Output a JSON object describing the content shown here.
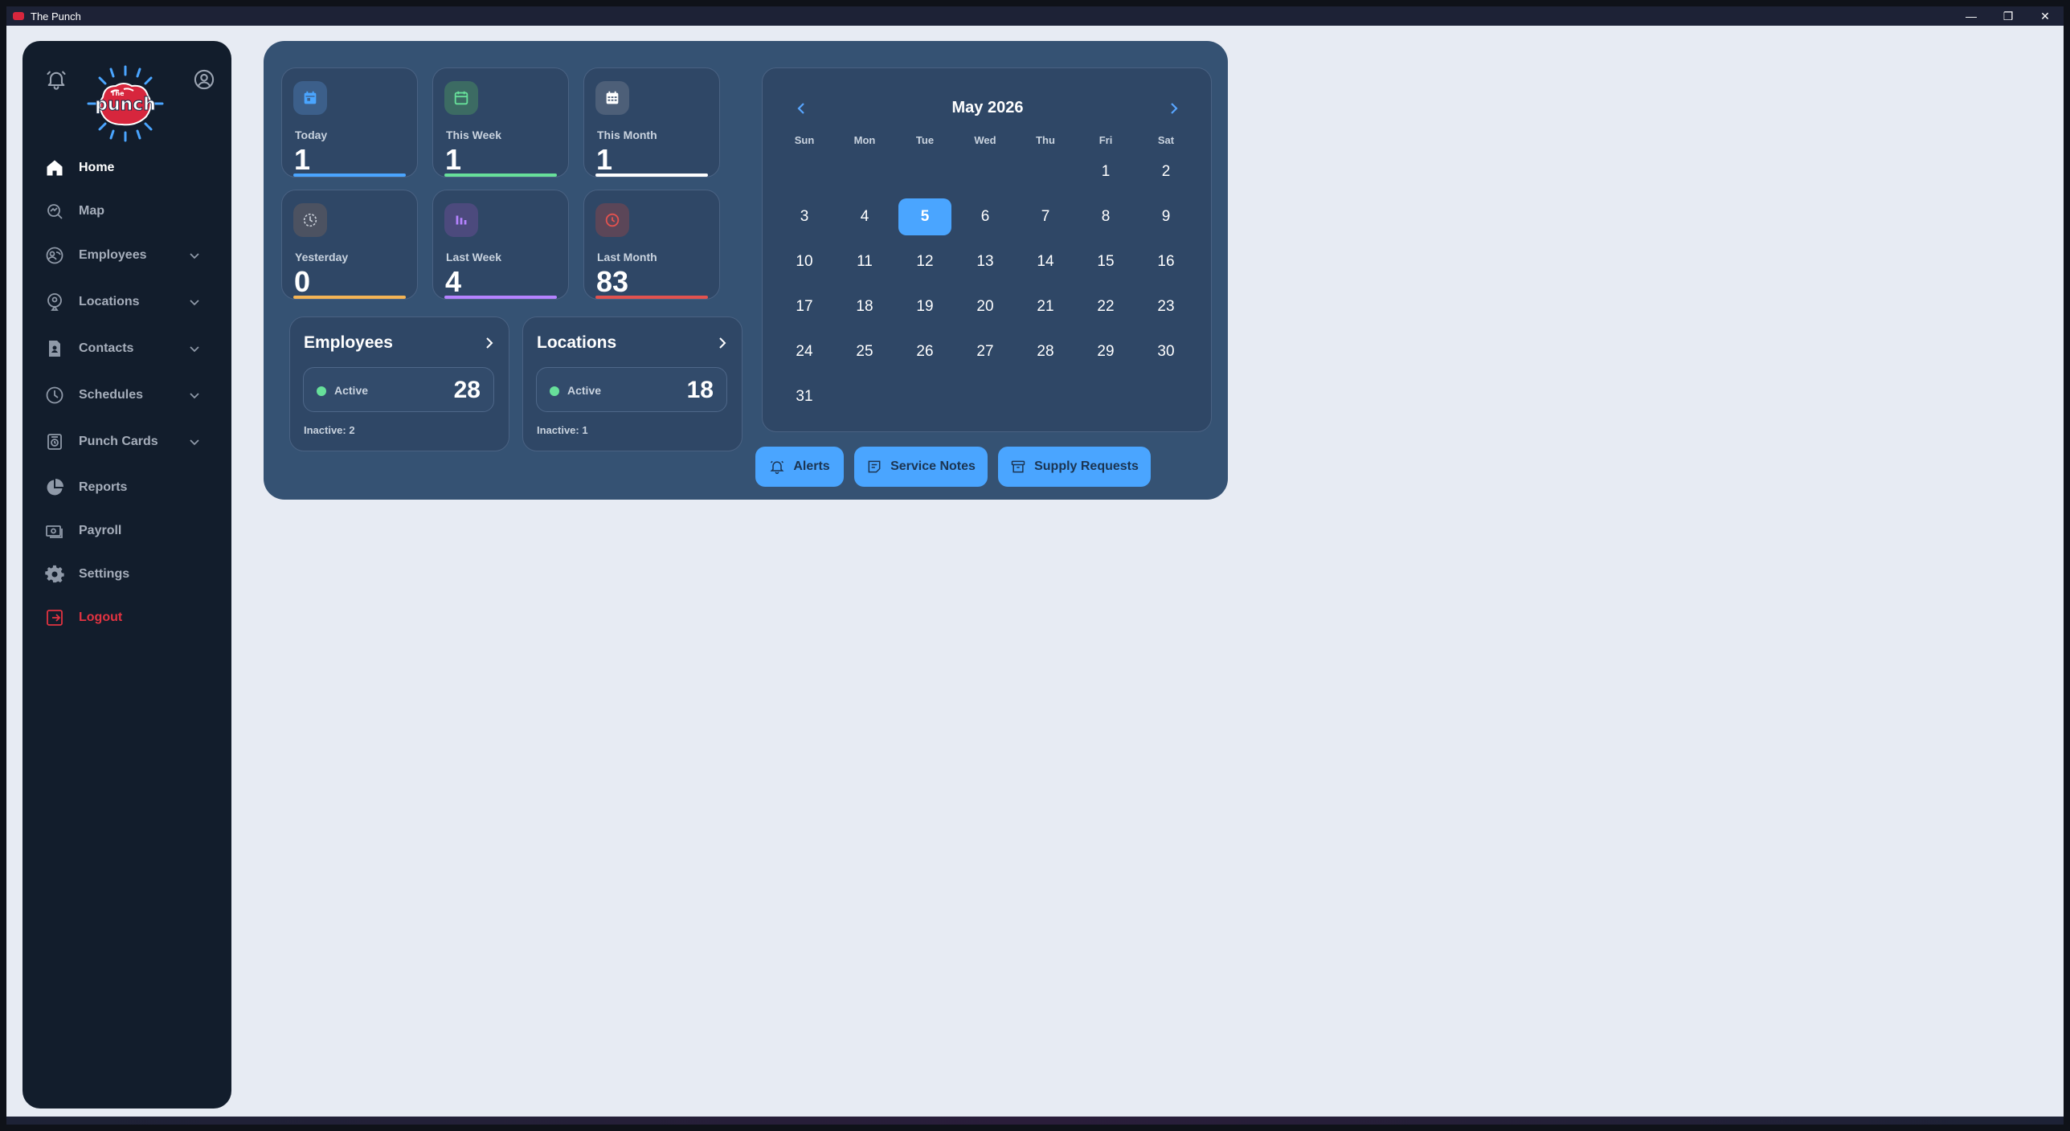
{
  "window": {
    "title": "The Punch",
    "controls": [
      "—",
      "❐",
      "✕"
    ]
  },
  "sidebar": {
    "logo_text": "punch",
    "logo_small_text": "The",
    "items": [
      {
        "label": "Home",
        "icon": "home-icon",
        "active": true,
        "expandable": false
      },
      {
        "label": "Map",
        "icon": "map-search-icon",
        "active": false,
        "expandable": false
      },
      {
        "label": "Employees",
        "icon": "employees-icon",
        "active": false,
        "expandable": true
      },
      {
        "label": "Locations",
        "icon": "location-pin-icon",
        "active": false,
        "expandable": true
      },
      {
        "label": "Contacts",
        "icon": "contacts-icon",
        "active": false,
        "expandable": true
      },
      {
        "label": "Schedules",
        "icon": "clock-icon",
        "active": false,
        "expandable": true
      },
      {
        "label": "Punch Cards",
        "icon": "punch-card-icon",
        "active": false,
        "expandable": true
      },
      {
        "label": "Reports",
        "icon": "pie-chart-icon",
        "active": false,
        "expandable": false
      },
      {
        "label": "Payroll",
        "icon": "payroll-icon",
        "active": false,
        "expandable": false
      },
      {
        "label": "Settings",
        "icon": "gear-icon",
        "active": false,
        "expandable": false
      },
      {
        "label": "Logout",
        "icon": "logout-icon",
        "active": false,
        "expandable": false
      }
    ]
  },
  "stats": [
    {
      "label": "Today",
      "value": "1",
      "color": "#4aa5ff",
      "icon_bg": "#3c5f8a",
      "icon": "calendar-day-icon"
    },
    {
      "label": "This Week",
      "value": "1",
      "color": "#67e09a",
      "icon_bg": "#3c6b63",
      "icon": "calendar-week-icon"
    },
    {
      "label": "This Month",
      "value": "1",
      "color": "#ffffff",
      "icon_bg": "#4d5f78",
      "icon": "calendar-month-icon"
    },
    {
      "label": "Yesterday",
      "value": "0",
      "color": "#f4b455",
      "icon_bg": "#4c5261",
      "icon": "history-icon"
    },
    {
      "label": "Last Week",
      "value": "4",
      "color": "#b583ff",
      "icon_bg": "#4c4a7d",
      "icon": "bar-chart-icon"
    },
    {
      "label": "Last Month",
      "value": "83",
      "color": "#e2524f",
      "icon_bg": "#5b4658",
      "icon": "alarm-clock-icon"
    }
  ],
  "employees_card": {
    "title": "Employees",
    "active_label": "Active",
    "active_count": "28",
    "inactive_text": "Inactive: 2"
  },
  "locations_card": {
    "title": "Locations",
    "active_label": "Active",
    "active_count": "18",
    "inactive_text": "Inactive: 1"
  },
  "calendar": {
    "month_label": "May 2026",
    "weekdays": [
      "Sun",
      "Mon",
      "Tue",
      "Wed",
      "Thu",
      "Fri",
      "Sat"
    ],
    "first_weekday_index": 5,
    "days_in_month": 31,
    "selected_day": 5
  },
  "quick_actions": [
    {
      "label": "Alerts",
      "icon": "bell-icon"
    },
    {
      "label": "Service Notes",
      "icon": "note-icon"
    },
    {
      "label": "Supply Requests",
      "icon": "archive-box-icon"
    }
  ]
}
